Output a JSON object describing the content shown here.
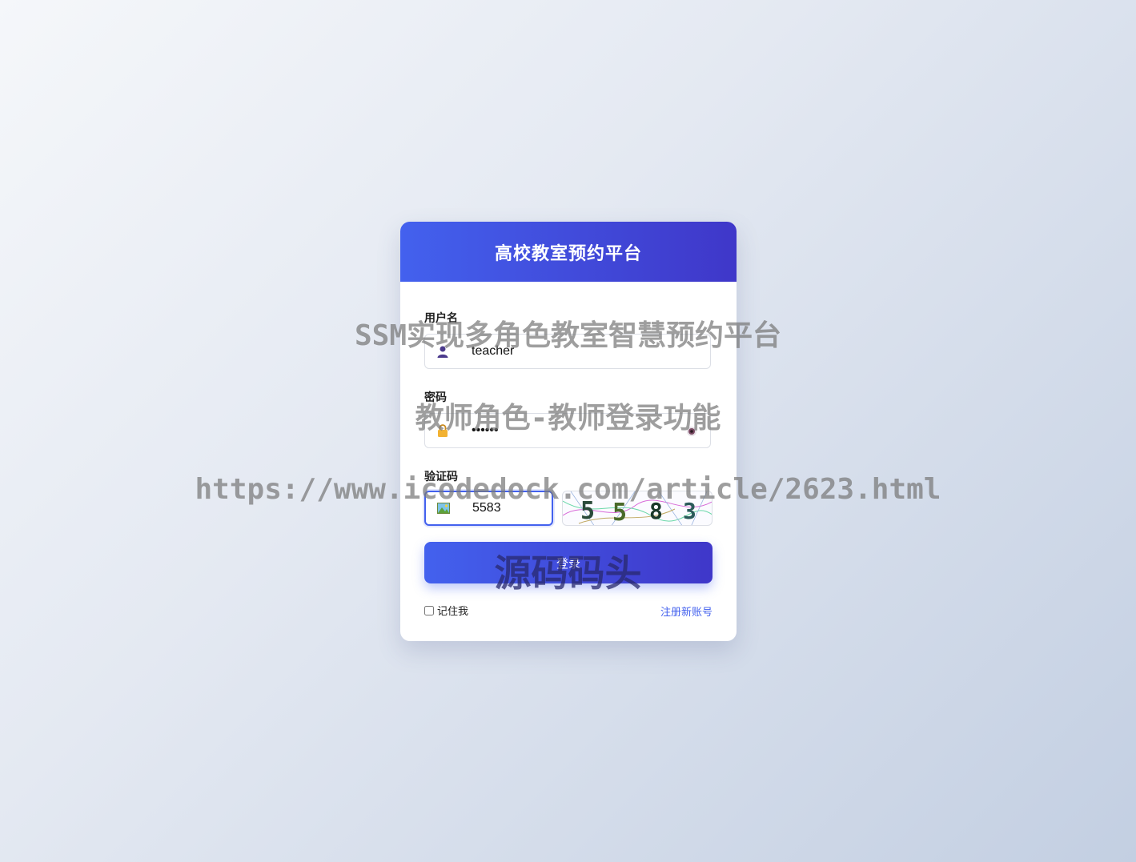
{
  "header": {
    "title": "高校教室预约平台"
  },
  "form": {
    "username": {
      "label": "用户名",
      "value": "teacher",
      "icon": "user-icon"
    },
    "password": {
      "label": "密码",
      "value": "••••••",
      "icon": "lock-icon",
      "toggle_icon": "eye-icon"
    },
    "captcha": {
      "label": "验证码",
      "value": "5583",
      "icon": "image-icon",
      "image_text": "558 3"
    },
    "login_label": "登录",
    "remember_label": "记住我",
    "register_label": "注册新账号"
  },
  "watermark": {
    "line1": "SSM实现多角色教室智慧预约平台",
    "line2": "教师角色-教师登录功能",
    "line3": "https://www.icodedock.com/article/2623.html",
    "line4": "源码码头"
  },
  "colors": {
    "accent": "#4361ee",
    "accent_dark": "#3f37c9"
  }
}
